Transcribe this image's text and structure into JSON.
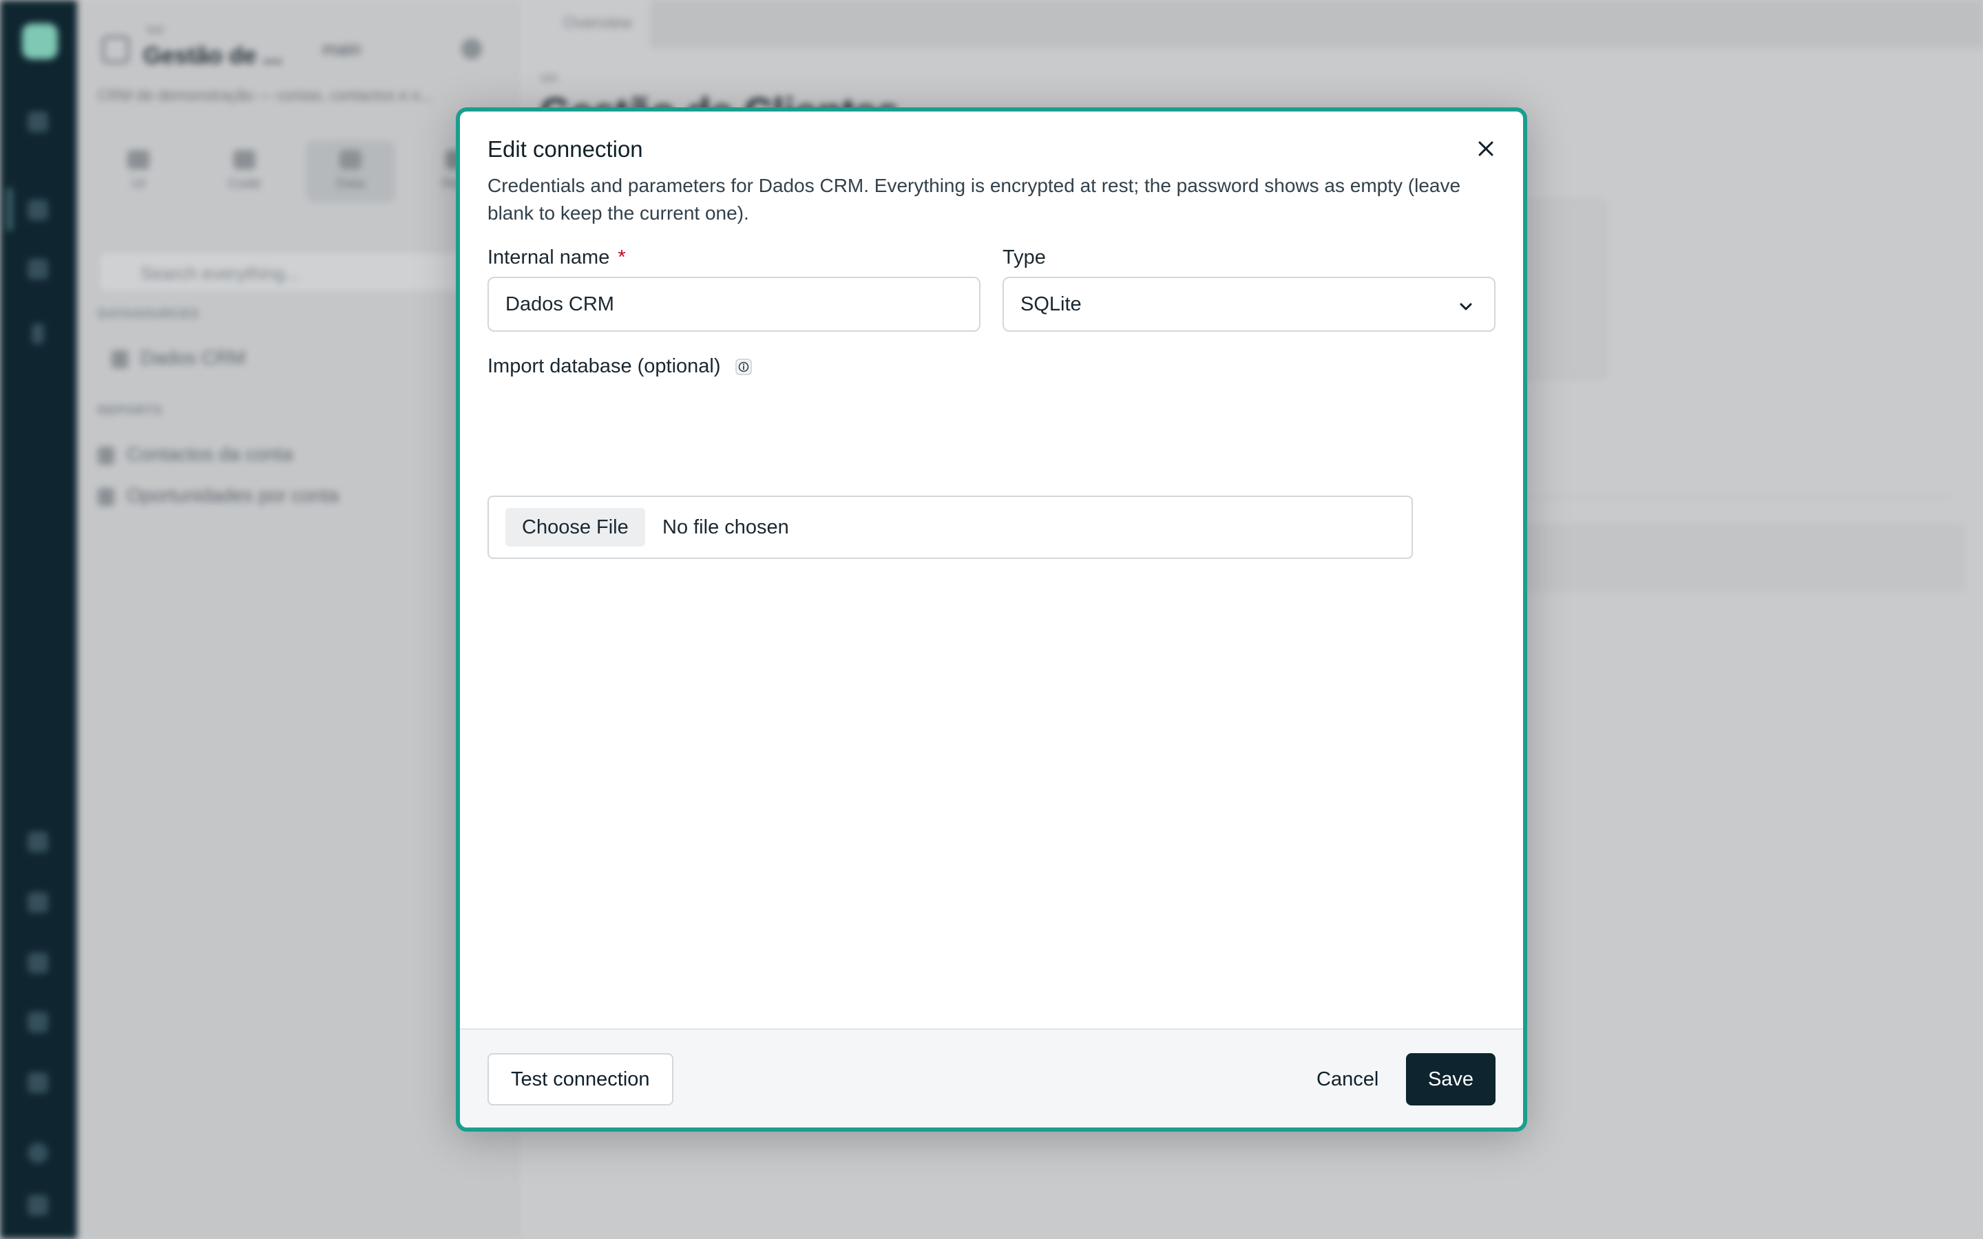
{
  "background": {
    "project": {
      "pre_label": "app",
      "name": "Gestão de ...",
      "branch": "main",
      "description": "CRM de demonstração — contas, contactos e o..."
    },
    "tabs": [
      {
        "label": "UI"
      },
      {
        "label": "Code"
      },
      {
        "label": "Data"
      },
      {
        "label": "Re..."
      }
    ],
    "search_placeholder": "Search everything...",
    "datasources_heading": "DATASOURCES",
    "datasource_item": "Dados CRM",
    "reports_heading": "REPORTS",
    "reports": [
      {
        "label": "Contactos da conta"
      },
      {
        "label": "Oportunidades por conta"
      }
    ],
    "overview_tab": "Overview",
    "page_crumb": "app",
    "page_title": "Gestão de Clientes"
  },
  "modal": {
    "title": "Edit connection",
    "description": "Credentials and parameters for Dados CRM. Everything is encrypted at rest; the password shows as empty (leave blank to keep the current one).",
    "internal_name_label": "Internal name",
    "required_mark": "*",
    "internal_name_value": "Dados CRM",
    "type_label": "Type",
    "type_value": "SQLite",
    "import_label": "Import database (optional)",
    "choose_file_label": "Choose File",
    "file_status": "No file chosen",
    "test_button": "Test connection",
    "cancel_button": "Cancel",
    "save_button": "Save"
  },
  "colors": {
    "modal_border": "#1a9e8e",
    "primary_button": "#0e2530",
    "required": "#d0021b",
    "rail": "#0f2530"
  },
  "icons": [
    "close-icon",
    "chevron-down-icon",
    "info-icon"
  ]
}
